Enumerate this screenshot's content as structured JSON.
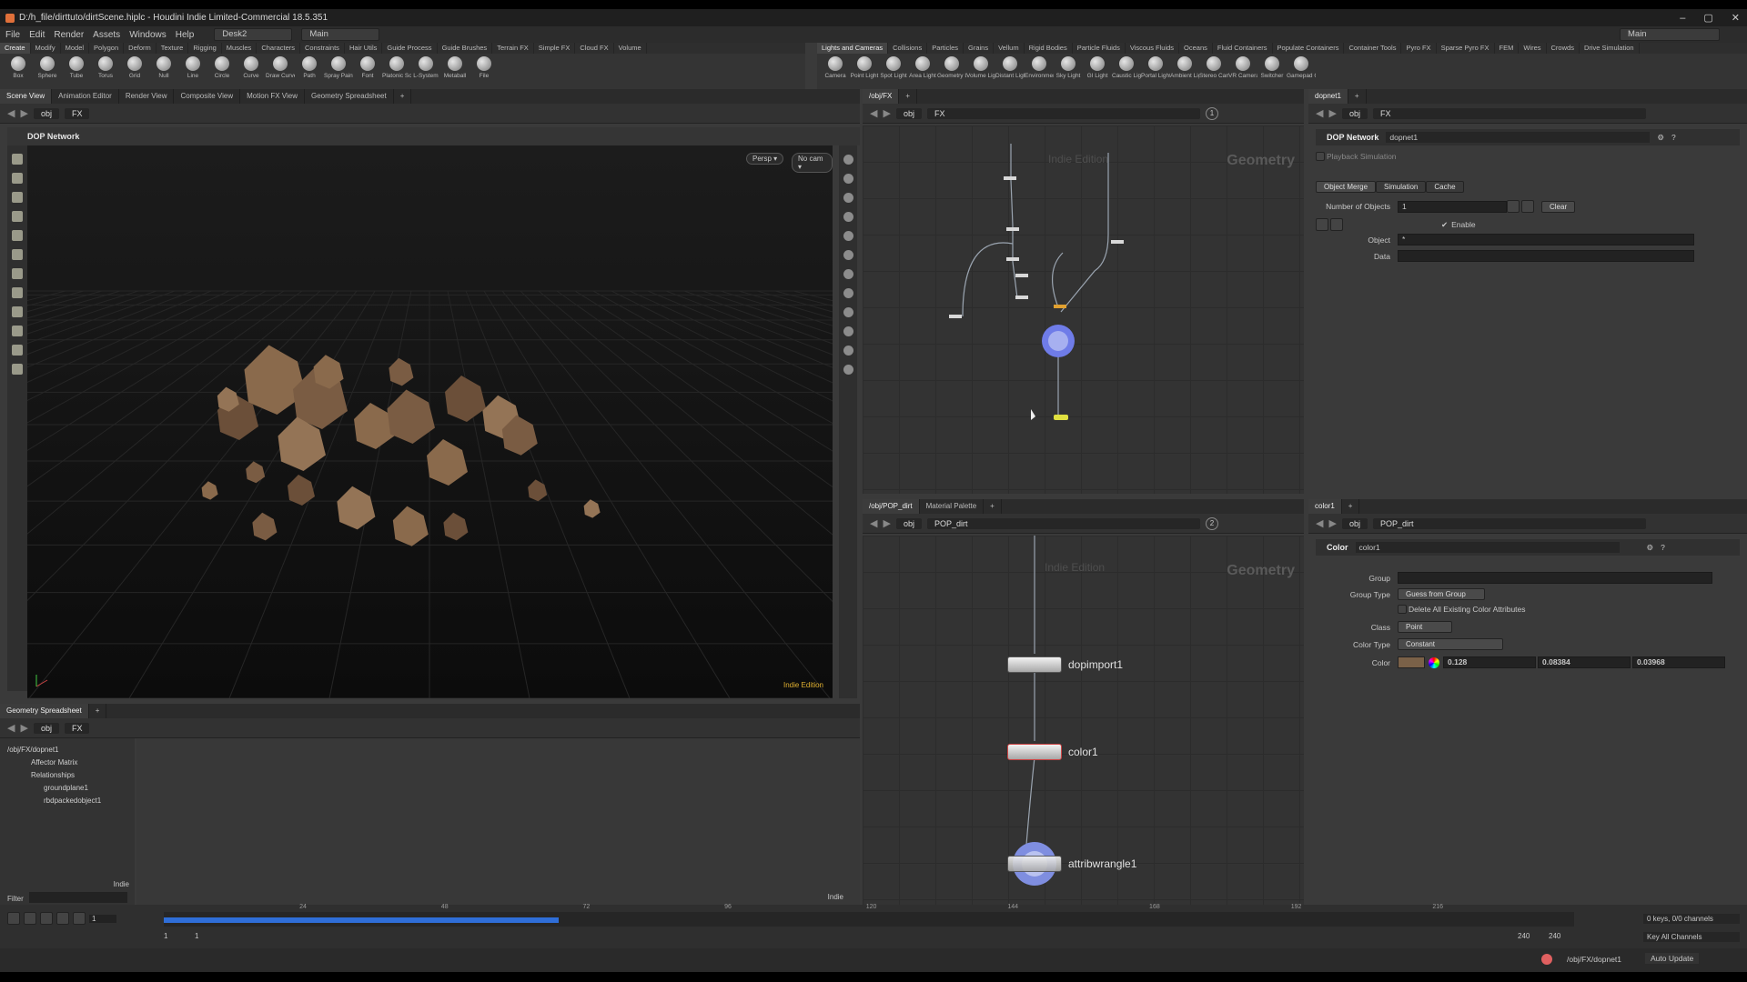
{
  "window": {
    "title": "D:/h_file/dirttuto/dirtScene.hiplc - Houdini Indie Limited-Commercial 18.5.351",
    "min": "–",
    "max": "▢",
    "close": "✕"
  },
  "menu": {
    "items": [
      "File",
      "Edit",
      "Render",
      "Assets",
      "Windows",
      "Help"
    ],
    "desk": "Desk2",
    "main": "Main",
    "right_main": "Main"
  },
  "shelf_left": {
    "tabs": [
      "Create",
      "Modify",
      "Model",
      "Polygon",
      "Deform",
      "Texture",
      "Rigging",
      "Muscles",
      "Characters",
      "Constraints",
      "Hair Utils",
      "Guide Process",
      "Guide Brushes",
      "Terrain FX",
      "Simple FX",
      "Cloud FX",
      "Volume"
    ],
    "tools": [
      "Box",
      "Sphere",
      "Tube",
      "Torus",
      "Grid",
      "Null",
      "Line",
      "Circle",
      "Curve",
      "Draw Curve",
      "Path",
      "Spray Paint",
      "Font",
      "Platonic Solids",
      "L-System",
      "Metaball",
      "File"
    ]
  },
  "shelf_right": {
    "tabs": [
      "Lights and Cameras",
      "Collisions",
      "Particles",
      "Grains",
      "Vellum",
      "Rigid Bodies",
      "Particle Fluids",
      "Viscous Fluids",
      "Oceans",
      "Fluid Containers",
      "Populate Containers",
      "Container Tools",
      "Pyro FX",
      "Sparse Pyro FX",
      "FEM",
      "Wires",
      "Crowds",
      "Drive Simulation"
    ],
    "tools": [
      "Camera",
      "Point Light",
      "Spot Light",
      "Area Light",
      "Geometry Light",
      "Volume Light",
      "Distant Light",
      "Environment Light",
      "Sky Light",
      "GI Light",
      "Caustic Light",
      "Portal Light",
      "Ambient Light",
      "Stereo Camera",
      "VR Camera",
      "Switcher",
      "Gamepad Camera"
    ]
  },
  "scene_view": {
    "tabs": [
      "Scene View",
      "Animation Editor",
      "Render View",
      "Composite View",
      "Motion FX View",
      "Geometry Spreadsheet"
    ],
    "path": [
      "obj",
      "FX"
    ],
    "title": "DOP Network",
    "persp": "Persp ▾",
    "cam": "No cam ▾",
    "watermark": "Indie Edition"
  },
  "net_top": {
    "tab": "/obj/FX",
    "path": [
      "obj",
      "FX"
    ],
    "label": "Geometry",
    "indie": "Indie Edition",
    "badge": "1"
  },
  "param_top": {
    "tab": "dopnet1",
    "path": [
      "obj",
      "FX"
    ],
    "type": "DOP Network",
    "name": "dopnet1",
    "playback": "Playback Simulation",
    "tabs": [
      "Object Merge",
      "Simulation",
      "Cache"
    ],
    "num_objects_label": "Number of Objects",
    "num_objects": "1",
    "clear": "Clear",
    "enable": "Enable",
    "object_label": "Object",
    "object_value": "*",
    "data_label": "Data"
  },
  "net_bottom": {
    "tabs": [
      "/obj/POP_dirt",
      "Material Palette"
    ],
    "path": [
      "obj",
      "POP_dirt"
    ],
    "label": "Geometry",
    "indie": "Indie Edition",
    "badge": "2",
    "nodes": [
      "dopimport1",
      "color1",
      "attribwrangle1"
    ]
  },
  "param_bottom": {
    "tab": "color1",
    "path": [
      "obj",
      "POP_dirt"
    ],
    "type": "Color",
    "name": "color1",
    "group_label": "Group",
    "group_type_label": "Group Type",
    "group_type": "Guess from Group",
    "delete_attr": "Delete All Existing Color Attributes",
    "class_label": "Class",
    "class": "Point",
    "color_type_label": "Color Type",
    "color_type": "Constant",
    "color_label": "Color",
    "r": "0.128",
    "g": "0.08384",
    "b": "0.03968",
    "swatch": "#7a6148"
  },
  "spreadsheet": {
    "tab": "Geometry Spreadsheet",
    "path": [
      "obj",
      "FX"
    ],
    "tree": [
      "/obj/FX/dopnet1",
      "Affector Matrix",
      "Relationships",
      "groundplane1",
      "rbdpackedobject1"
    ],
    "indie": "Indie",
    "filter": "Filter"
  },
  "timeline": {
    "frame": "1",
    "ticks": [
      "24",
      "48",
      "72",
      "96",
      "120",
      "144",
      "168",
      "192",
      "216"
    ],
    "start": "1",
    "start2": "1",
    "end": "240",
    "end2": "240",
    "keys": "0 keys, 0/0 channels",
    "keyall": "Key All Channels",
    "cached_fraction": 0.28
  },
  "status": {
    "path": "/obj/FX/dopnet1",
    "update": "Auto Update"
  },
  "colors": {
    "accent": "#2f6ed8",
    "dirt": "#7a5c43"
  }
}
